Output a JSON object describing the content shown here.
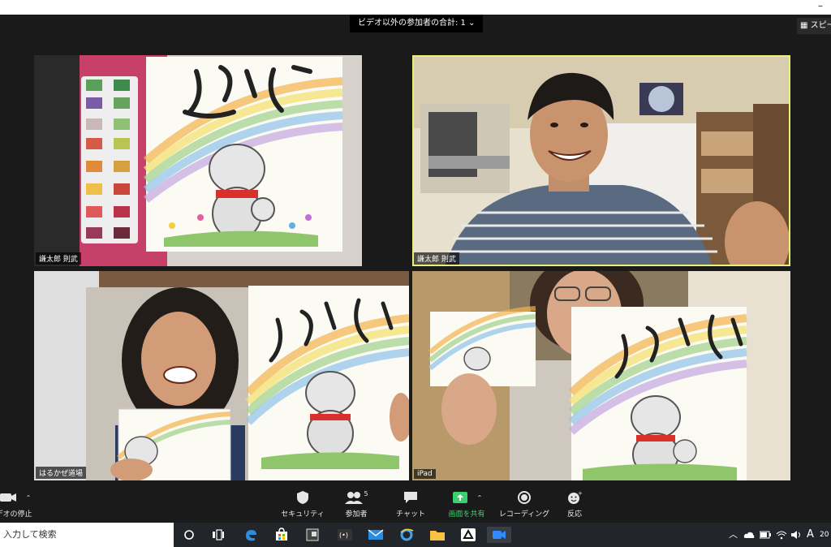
{
  "window": {
    "minimize": "–"
  },
  "top_banner": {
    "label": "ビデオ以外の参加者の合計: 1 ⌄"
  },
  "view_toggle": {
    "label": "スピー"
  },
  "tiles": [
    {
      "name": "謙太郎 則武"
    },
    {
      "name": "謙太郎 則武"
    },
    {
      "name": "はるかぜ道場"
    },
    {
      "name": "iPad"
    }
  ],
  "toolbar": {
    "video": {
      "label": "デオの停止"
    },
    "security": {
      "label": "セキュリティ"
    },
    "participants": {
      "label": "参加者",
      "count": "5"
    },
    "chat": {
      "label": "チャット"
    },
    "share": {
      "label": "画面を共有"
    },
    "record": {
      "label": "レコーディング"
    },
    "reactions": {
      "label": "反応"
    }
  },
  "taskbar": {
    "search_placeholder": "入力して検索",
    "ime": "A",
    "clock": "20"
  },
  "colors": {
    "accent_green": "#3ccf6d",
    "active_speaker": "#e8f07a",
    "toolbar_bg": "#1a1a1a"
  }
}
